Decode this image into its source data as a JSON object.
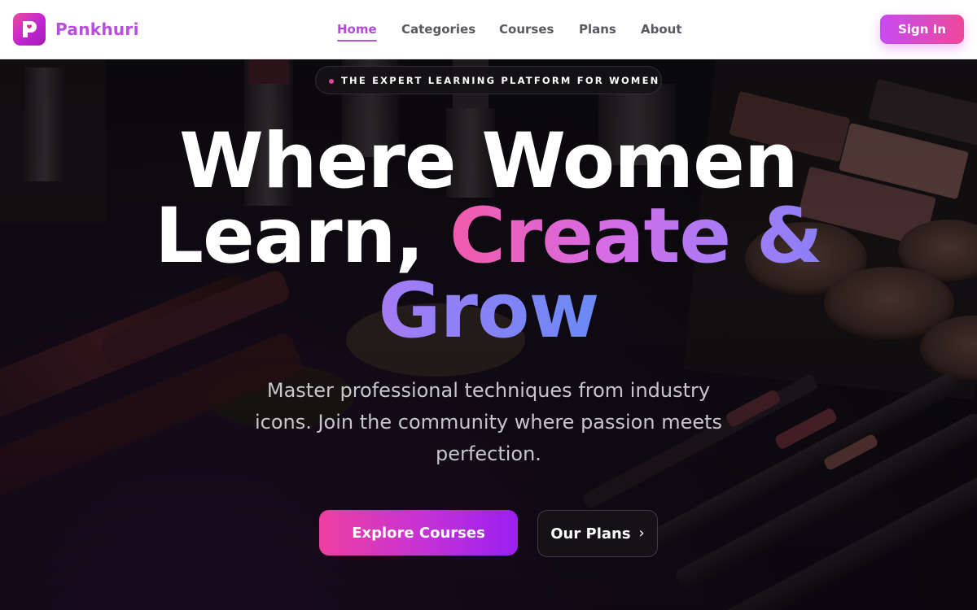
{
  "brand": {
    "name": "Pankhuri",
    "logo_icon": "p-heart-logo-icon",
    "accent": "#b94de0"
  },
  "nav": {
    "items": [
      {
        "label": "Home",
        "active": true
      },
      {
        "label": "Categories",
        "active": false
      },
      {
        "label": "Courses",
        "active": false
      },
      {
        "label": "Plans",
        "active": false
      },
      {
        "label": "About",
        "active": false
      }
    ],
    "signin_label": "Sign In"
  },
  "hero": {
    "badge": "THE EXPERT LEARNING PLATFORM FOR WOMEN",
    "headline": {
      "line1": "Where Women",
      "line2_plain": "Learn, ",
      "line2_accent": "Create &",
      "line3_accent": "Grow"
    },
    "subtitle": "Master professional techniques from industry icons. Join the community where passion meets perfection.",
    "primary_cta": "Explore Courses",
    "secondary_cta": "Our Plans",
    "secondary_icon": "chevron-right-icon",
    "background_image": "makeup-palette-lipsticks-photo"
  },
  "colors": {
    "gradient_pink": "#ec4899",
    "gradient_purple": "#9a1ff0",
    "headline_accent_start": "#f25aa9",
    "headline_accent_end": "#6b8af5"
  }
}
